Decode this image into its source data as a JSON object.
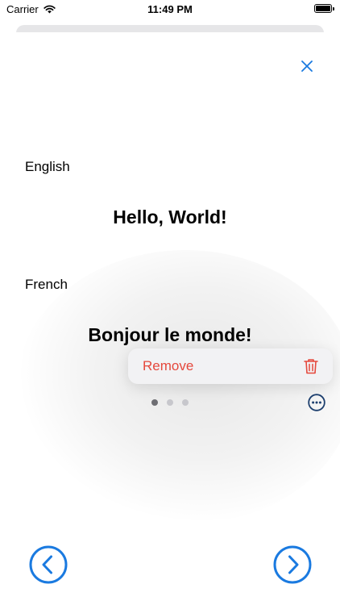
{
  "status_bar": {
    "carrier": "Carrier",
    "time": "11:49 PM"
  },
  "card": {
    "source_language": "English",
    "source_text": "Hello, World!",
    "target_language": "French",
    "target_text": "Bonjour le monde!",
    "page_count": 3,
    "current_page": 1
  },
  "context_menu": {
    "remove_label": "Remove"
  },
  "icons": {
    "close": "close-icon",
    "trash": "trash-icon",
    "more": "ellipsis-circle-icon",
    "previous": "chevron-left-circle-icon",
    "next": "chevron-right-circle-icon"
  },
  "colors": {
    "accent": "#1a7ae0",
    "destructive": "#e5483c",
    "more_icon": "#1d3f6e"
  }
}
